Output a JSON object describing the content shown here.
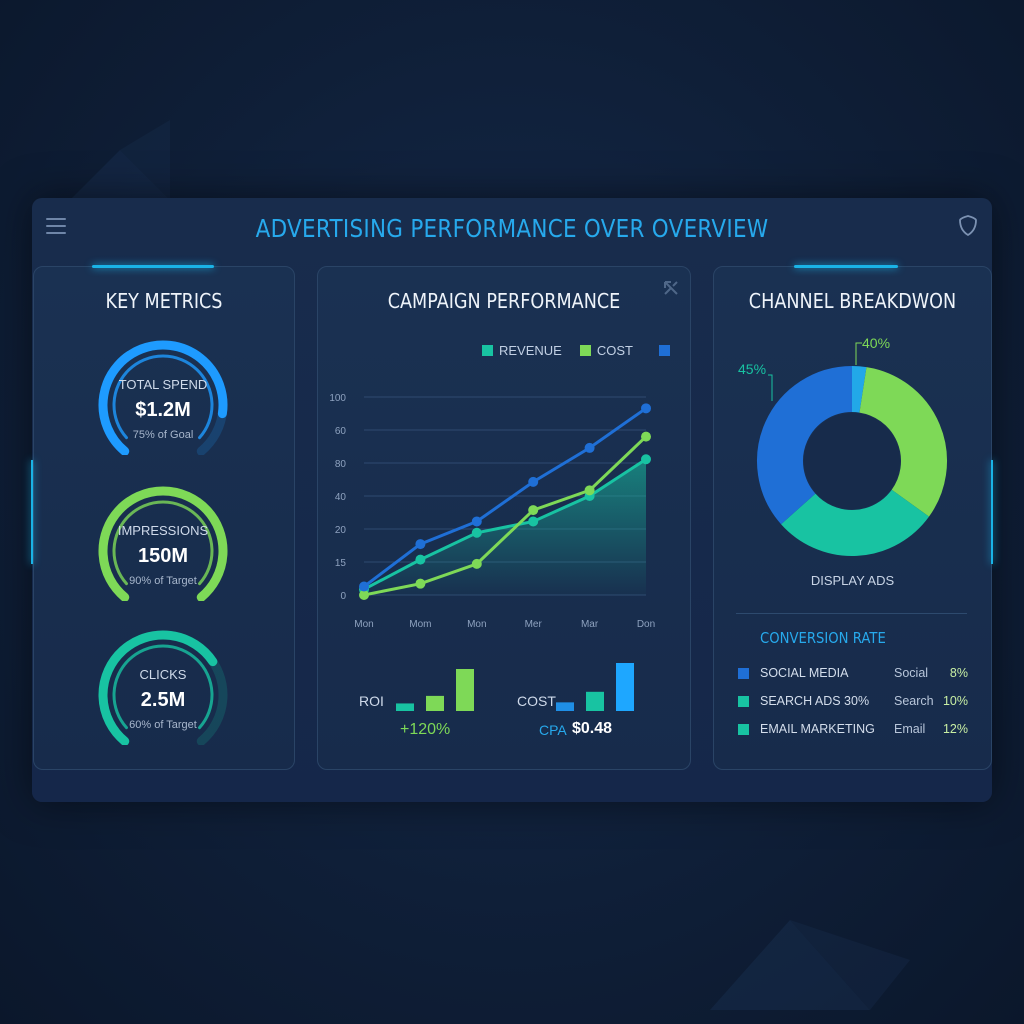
{
  "app": {
    "title": "ADVERTISING PERFORMANCE OVER OVERVIEW"
  },
  "colors": {
    "accent": "#27a9ec",
    "blue": "#1f6fd6",
    "green": "#7ed957",
    "teal": "#18c3a2"
  },
  "key_metrics": {
    "title": "KEY METRICS",
    "gauges": [
      {
        "label": "TOTAL SPEND",
        "value": "$1.2M",
        "sub": "75% of Goal",
        "progress": 0.75,
        "color": "#1e9bff"
      },
      {
        "label": "IMPRESSIONS",
        "value": "150M",
        "sub": "90% of Target",
        "progress": 0.9,
        "color": "#7ed957"
      },
      {
        "label": "CLICKS",
        "value": "2.5M",
        "sub": "60% of Target",
        "progress": 0.6,
        "color": "#18c3a2"
      }
    ]
  },
  "campaign": {
    "title": "CAMPAIGN PERFORMANCE",
    "legend": [
      {
        "label": "REVENUE",
        "color": "#18c3a2"
      },
      {
        "label": "COST",
        "color": "#7ed957"
      },
      {
        "label": "",
        "color": "#1f6fd6"
      }
    ],
    "roi_label": "ROI",
    "roi_value": "+120%",
    "cost_label": "COST",
    "cpa_label": "CPA",
    "cpa_value": "$0.48",
    "roi_bars": [
      0.18,
      0.36,
      1.0
    ],
    "cost_bars": [
      0.18,
      0.4,
      1.0
    ]
  },
  "chart_data": {
    "type": "line",
    "x": [
      "Mon",
      "Mom",
      "Mon",
      "Mer",
      "Mar",
      "Don"
    ],
    "y_ticks": [
      "0",
      "15",
      "20",
      "40",
      "80",
      "60",
      "100"
    ],
    "series": [
      {
        "name": "REVENUE",
        "color": "#18c3a2",
        "values": [
          4,
          25,
          44,
          52,
          70,
          96
        ]
      },
      {
        "name": "COST",
        "color": "#7ed957",
        "values": [
          0,
          8,
          22,
          60,
          74,
          112
        ]
      },
      {
        "name": "",
        "color": "#1f6fd6",
        "values": [
          6,
          36,
          52,
          80,
          104,
          132
        ]
      }
    ]
  },
  "channel": {
    "title": "CHANNEL BREAKDWON",
    "donut": [
      {
        "label": "",
        "value": 45,
        "color": "#1f6fd6"
      },
      {
        "label": "",
        "value": 35,
        "color": "#18c3a2"
      },
      {
        "label": "",
        "value": 40,
        "color": "#7ed957"
      },
      {
        "label": "",
        "value": 3,
        "color": "#22a8e8"
      }
    ],
    "left_pct": "45%",
    "top_pct": "40%",
    "center_caption": "DISPLAY ADS",
    "conversion_title": "CONVERSION RATE",
    "rows": [
      {
        "name": "SOCIAL MEDIA",
        "short": "Social",
        "pct": "8%",
        "color": "#1f6fd6"
      },
      {
        "name": "SEARCH ADS  30%",
        "short": "Search",
        "pct": "10%",
        "color": "#18c3a2"
      },
      {
        "name": "EMAIL MARKETING",
        "short": "Email",
        "pct": "12%",
        "color": "#18c3a2"
      }
    ]
  }
}
